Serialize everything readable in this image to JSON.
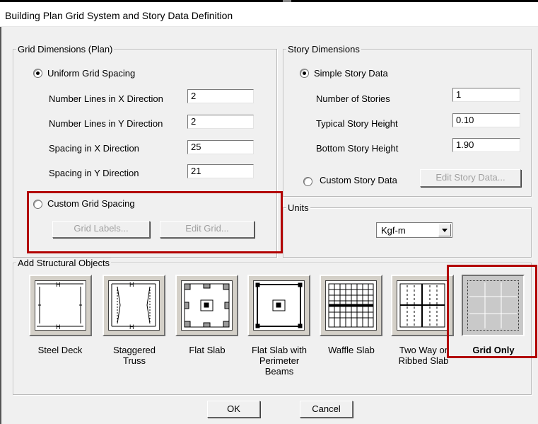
{
  "window": {
    "title": "Building Plan Grid System and Story Data Definition"
  },
  "grid": {
    "legend": "Grid Dimensions (Plan)",
    "uniform_label": "Uniform Grid Spacing",
    "uniform_selected": true,
    "fields": [
      {
        "label": "Number Lines in X Direction",
        "value": "2"
      },
      {
        "label": "Number Lines in Y Direction",
        "value": "2"
      },
      {
        "label": "Spacing in X Direction",
        "value": "25"
      },
      {
        "label": "Spacing in Y Direction",
        "value": "21"
      }
    ],
    "custom_label": "Custom Grid Spacing",
    "custom_selected": false,
    "grid_labels_button": "Grid Labels...",
    "edit_grid_button": "Edit Grid..."
  },
  "story": {
    "legend": "Story Dimensions",
    "simple_label": "Simple Story Data",
    "simple_selected": true,
    "fields": [
      {
        "label": "Number of Stories",
        "value": "1"
      },
      {
        "label": "Typical Story Height",
        "value": "0.10"
      },
      {
        "label": "Bottom Story Height",
        "value": "1.90"
      }
    ],
    "custom_label": "Custom Story Data",
    "custom_selected": false,
    "edit_story_button": "Edit Story Data..."
  },
  "units": {
    "legend": "Units",
    "selected": "Kgf-m"
  },
  "structural": {
    "legend": "Add Structural Objects",
    "options": [
      {
        "line1": "Steel Deck",
        "line2": "",
        "icon": "steel-deck-icon"
      },
      {
        "line1": "Staggered",
        "line2": "Truss",
        "icon": "staggered-truss-icon"
      },
      {
        "line1": "Flat Slab",
        "line2": "",
        "icon": "flat-slab-icon"
      },
      {
        "line1": "Flat Slab with",
        "line2": "Perimeter Beams",
        "icon": "flat-slab-perimeter-beams-icon"
      },
      {
        "line1": "Waffle Slab",
        "line2": "",
        "icon": "waffle-slab-icon"
      },
      {
        "line1": "Two Way or",
        "line2": "Ribbed Slab",
        "icon": "two-way-ribbed-slab-icon"
      },
      {
        "line1": "Grid Only",
        "line2": "",
        "icon": "grid-only-icon",
        "selected": true
      }
    ]
  },
  "buttons": {
    "ok": "OK",
    "cancel": "Cancel"
  },
  "colors": {
    "highlight": "#b20000",
    "dialog_bg": "#f0f0f0"
  }
}
